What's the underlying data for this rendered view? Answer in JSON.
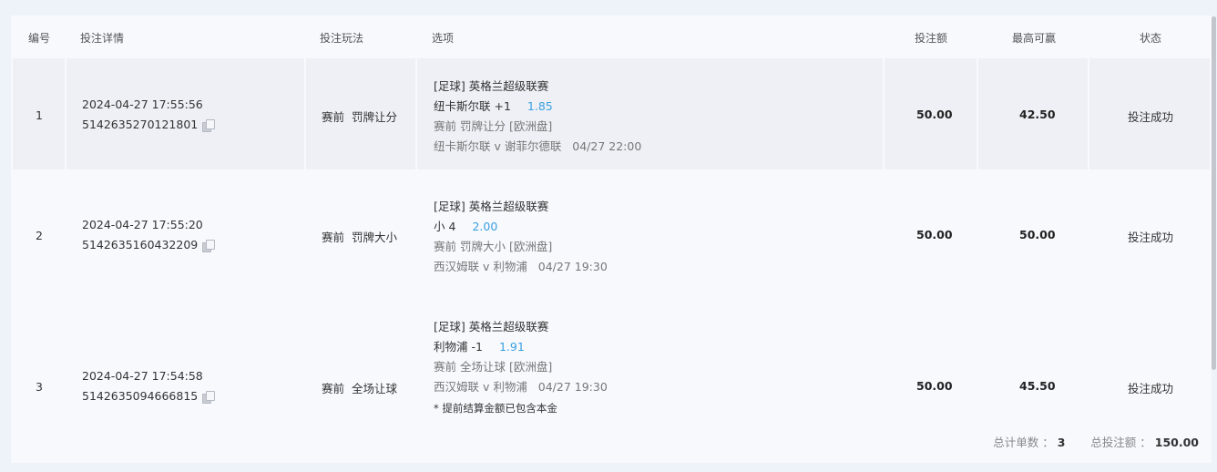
{
  "headers": {
    "no": "编号",
    "detail": "投注详情",
    "play": "投注玩法",
    "option": "选项",
    "amount": "投注额",
    "max_win": "最高可赢",
    "status": "状态"
  },
  "rows": [
    {
      "no": "1",
      "datetime": "2024-04-27 17:55:56",
      "order_id": "5142635270121801",
      "play_stage": "赛前",
      "play_type": "罚牌让分",
      "league": "[足球] 英格兰超级联赛",
      "selection": "纽卡斯尔联 +1",
      "odds": "1.85",
      "market": "赛前 罚牌让分 [欧洲盘]",
      "match": "纽卡斯尔联 v 谢菲尔德联",
      "match_time": "04/27 22:00",
      "amount": "50.00",
      "max_win": "42.50",
      "status": "投注成功"
    },
    {
      "no": "2",
      "datetime": "2024-04-27 17:55:20",
      "order_id": "5142635160432209",
      "play_stage": "赛前",
      "play_type": "罚牌大小",
      "league": "[足球] 英格兰超级联赛",
      "selection": "小 4",
      "odds": "2.00",
      "market": "赛前 罚牌大小 [欧洲盘]",
      "match": "西汉姆联 v 利物浦",
      "match_time": "04/27 19:30",
      "amount": "50.00",
      "max_win": "50.00",
      "status": "投注成功"
    },
    {
      "no": "3",
      "datetime": "2024-04-27 17:54:58",
      "order_id": "5142635094666815",
      "play_stage": "赛前",
      "play_type": "全场让球",
      "league": "[足球] 英格兰超级联赛",
      "selection": "利物浦 -1",
      "odds": "1.91",
      "market": "赛前 全场让球 [欧洲盘]",
      "match": "西汉姆联 v 利物浦",
      "match_time": "04/27 19:30",
      "note": "* 提前结算金额已包含本金",
      "amount": "50.00",
      "max_win": "45.50",
      "status": "投注成功"
    }
  ],
  "footer": {
    "count_label": "总计单数 ：",
    "count": "3",
    "total_label": "总投注额 ：",
    "total": "150.00"
  }
}
